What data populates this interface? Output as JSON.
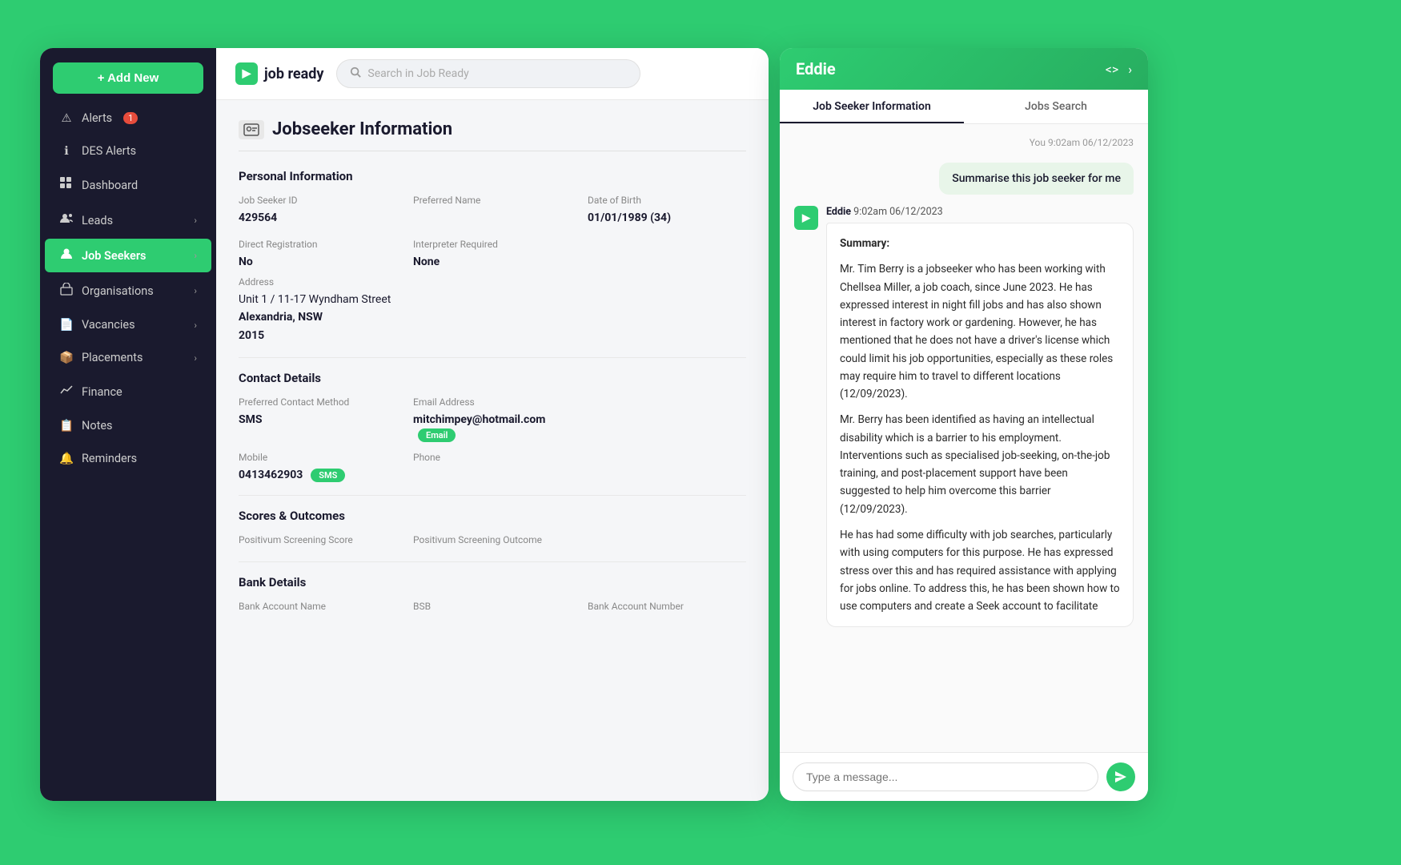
{
  "app": {
    "name": "job ready",
    "logo_symbol": "▶",
    "search_placeholder": "Search in Job Ready"
  },
  "sidebar": {
    "add_button": "+ Add New",
    "items": [
      {
        "id": "alerts",
        "label": "Alerts",
        "icon": "⚠",
        "badge": "1",
        "active": false
      },
      {
        "id": "des-alerts",
        "label": "DES Alerts",
        "icon": "ℹ",
        "active": false
      },
      {
        "id": "dashboard",
        "label": "Dashboard",
        "icon": "⊞",
        "active": false
      },
      {
        "id": "leads",
        "label": "Leads",
        "icon": "👤+",
        "has_chevron": true,
        "active": false
      },
      {
        "id": "job-seekers",
        "label": "Job Seekers",
        "icon": "👤",
        "has_chevron": true,
        "active": true
      },
      {
        "id": "organisations",
        "label": "Organisations",
        "icon": "🏢",
        "has_chevron": true,
        "active": false
      },
      {
        "id": "vacancies",
        "label": "Vacancies",
        "icon": "📄",
        "has_chevron": true,
        "active": false
      },
      {
        "id": "placements",
        "label": "Placements",
        "icon": "📦",
        "has_chevron": true,
        "active": false
      },
      {
        "id": "finance",
        "label": "Finance",
        "icon": "📈",
        "active": false
      },
      {
        "id": "notes",
        "label": "Notes",
        "icon": "📋",
        "active": false
      },
      {
        "id": "reminders",
        "label": "Reminders",
        "icon": "🔔",
        "active": false
      }
    ]
  },
  "jobseeker_page": {
    "title": "Jobseeker Information",
    "sections": {
      "personal_info": {
        "heading": "Personal Information",
        "fields": {
          "job_seeker_id_label": "Job Seeker ID",
          "job_seeker_id": "429564",
          "preferred_name_label": "Preferred Name",
          "preferred_name": "",
          "date_of_birth_label": "Date of Birth",
          "date_of_birth": "01/01/1989 (34)",
          "direct_registration_label": "Direct Registration",
          "direct_registration": "No",
          "interpreter_required_label": "Interpreter Required",
          "interpreter_required": "None",
          "address_label": "Address",
          "address_line1": "Unit 1 / 11-17 Wyndham Street",
          "address_line2": "Alexandria, NSW",
          "address_postcode": "2015"
        }
      },
      "contact_details": {
        "heading": "Contact Details",
        "preferred_contact_method_label": "Preferred Contact Method",
        "preferred_contact_method": "SMS",
        "email_address_label": "Email Address",
        "email_address": "mitchimpey@hotmail.com",
        "email_badge": "Email",
        "mobile_label": "Mobile",
        "mobile": "0413462903",
        "sms_badge": "SMS",
        "phone_label": "Phone",
        "phone": ""
      },
      "scores_outcomes": {
        "heading": "Scores & Outcomes",
        "positivum_screening_score_label": "Positivum Screening Score",
        "positivum_screening_outcome_label": "Positivum Screening Outcome"
      },
      "bank_details": {
        "heading": "Bank Details",
        "bank_account_name_label": "Bank Account Name",
        "bsb_label": "BSB",
        "bank_account_number_label": "Bank Account Number"
      }
    }
  },
  "eddie": {
    "title": "Eddie",
    "tabs": [
      {
        "id": "job-seeker-info",
        "label": "Job Seeker Information",
        "active": true
      },
      {
        "id": "jobs-search",
        "label": "Jobs Search",
        "active": false
      }
    ],
    "conversation": {
      "user_timestamp": "You 9:02am 06/12/2023",
      "user_message": "Summarise this job seeker for me",
      "eddie_timestamp": "Eddie 9:02am 06/12/2023",
      "eddie_name": "Eddie",
      "eddie_time": "9:02am 06/12/2023",
      "summary_label": "Summary:",
      "paragraphs": [
        "Mr. Tim Berry is a jobseeker who has been working with Chellsea Miller, a job coach, since June 2023. He has expressed interest in night fill jobs and has also shown interest in factory work or gardening. However, he has mentioned that he does not have a driver's license which could limit his job opportunities, especially as these roles may require him to travel to different locations (12/09/2023).",
        "Mr. Berry has been identified as having an intellectual disability which is a barrier to his employment. Interventions such as specialised job-seeking, on-the-job training, and post-placement support have been suggested to help him overcome this barrier (12/09/2023).",
        "He has had some difficulty with job searches, particularly with using computers for this purpose. He has expressed stress over this and has required assistance with applying for jobs online. To address this, he has been shown how to use computers and create a Seek account to facilitate"
      ]
    },
    "chat_input_placeholder": "Type a message..."
  }
}
